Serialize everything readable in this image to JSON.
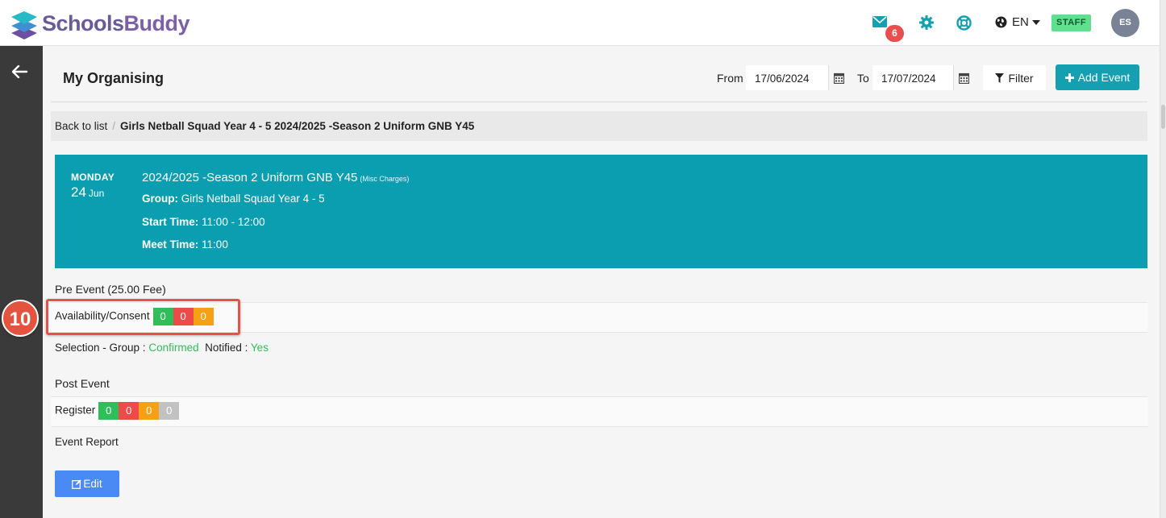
{
  "app": {
    "logo_text_a": "Schools",
    "logo_text_b": "Buddy"
  },
  "topbar": {
    "message_count": "6",
    "language": "EN",
    "role_badge": "STAFF",
    "user_initials": "ES"
  },
  "page": {
    "title": "My Organising",
    "from_label": "From",
    "from_date": "17/06/2024",
    "to_label": "To",
    "to_date": "17/07/2024",
    "filter_label": "Filter",
    "add_event_label": "Add Event"
  },
  "breadcrumb": {
    "back": "Back to list",
    "current": "Girls Netball Squad Year 4 - 5 2024/2025 -Season 2 Uniform GNB Y45"
  },
  "event": {
    "weekday": "MONDAY",
    "day": "24",
    "month": "Jun",
    "title": "2024/2025 -Season 2 Uniform GNB Y45",
    "title_note": "(Misc Charges)",
    "group_label": "Group:",
    "group_value": "Girls Netball Squad Year 4 - 5",
    "start_label": "Start Time:",
    "start_value": "11:00 - 12:00",
    "meet_label": "Meet Time:",
    "meet_value": "11:00"
  },
  "pre_event": {
    "heading": "Pre Event (25.00 Fee)",
    "availability_label": "Availability/Consent",
    "availability_counts": [
      "0",
      "0",
      "0"
    ],
    "selection_label": "Selection - Group :",
    "selection_value": "Confirmed",
    "notified_label": "Notified :",
    "notified_value": "Yes"
  },
  "post_event": {
    "heading": "Post Event",
    "register_label": "Register",
    "register_counts": [
      "0",
      "0",
      "0",
      "0"
    ],
    "report_label": "Event Report",
    "edit_label": "Edit"
  },
  "annotation": {
    "step_number": "10"
  },
  "colors": {
    "brand_teal": "#0a9eb0",
    "green": "#2fbe59",
    "red": "#ef4a4a",
    "orange": "#f6a013",
    "grey": "#c2c2c2",
    "edit_blue": "#4a8af4"
  }
}
